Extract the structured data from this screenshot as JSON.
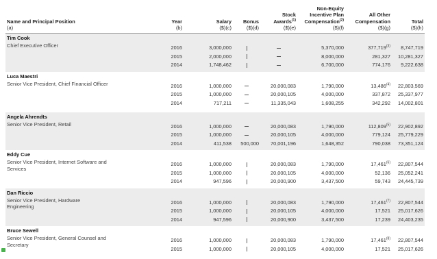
{
  "headers": {
    "name": "Name and Principal Position",
    "name_sub": "(a)",
    "year": "Year",
    "year_sub": "(b)",
    "salary": "Salary",
    "salary_sub": "($)(c)",
    "bonus": "Bonus",
    "bonus_sub": "($)(d)",
    "stock_line1": "Stock",
    "stock_line2": "Awards",
    "stock_note": "(1)",
    "stock_sub": "($)(e)",
    "nonequity_line1": "Non-Equity",
    "nonequity_line2": "Incentive Plan",
    "nonequity_line3": "Compensation",
    "nonequity_note": "(2)",
    "nonequity_sub": "($)(f)",
    "other_line1": "All Other",
    "other_line2": "Compensation",
    "other_sub": "($)(g)",
    "total": "Total",
    "total_sub": "($)(h)"
  },
  "executives": [
    {
      "name": "Tim Cook",
      "title": "Chief Executive Officer",
      "years": [
        "2016",
        "2015",
        "2014"
      ],
      "salary": [
        "3,000,000",
        "2,000,000",
        "1,748,462"
      ],
      "bonus_style": "vertical",
      "stock_awards": [
        "—",
        "—",
        "—"
      ],
      "non_equity": [
        "5,370,000",
        "8,000,000",
        "6,700,000"
      ],
      "other": [
        "377,719",
        "281,327",
        "774,176"
      ],
      "other_note": "(3)",
      "total": [
        "8,747,719",
        "10,281,327",
        "9,222,638"
      ]
    },
    {
      "name": "Luca Maestri",
      "title": "Senior Vice President, Chief Financial Officer",
      "years": [
        "2016",
        "2015",
        "2014"
      ],
      "salary": [
        "1,000,000",
        "1,000,000",
        "717,211"
      ],
      "bonus": [
        "—",
        "—",
        "—"
      ],
      "stock_awards": [
        "20,000,083",
        "20,000,105",
        "11,335,043"
      ],
      "non_equity": [
        "1,790,000",
        "4,000,000",
        "1,608,255"
      ],
      "other": [
        "13,486",
        "337,872",
        "342,292"
      ],
      "other_note": "(4)",
      "total": [
        "22,803,569",
        "25,337,977",
        "14,002,801"
      ]
    },
    {
      "name": "Angela Ahrendts",
      "title": "Senior Vice President, Retail",
      "years": [
        "2016",
        "2015",
        "2014"
      ],
      "salary": [
        "1,000,000",
        "1,000,000",
        "411,538"
      ],
      "bonus": [
        "—",
        "—",
        "500,000"
      ],
      "stock_awards": [
        "20,000,083",
        "20,000,105",
        "70,001,196"
      ],
      "non_equity": [
        "1,790,000",
        "4,000,000",
        "1,648,352"
      ],
      "other": [
        "112,809",
        "779,124",
        "790,038"
      ],
      "other_note": "(5)",
      "total": [
        "22,902,892",
        "25,779,229",
        "73,351,124"
      ]
    },
    {
      "name": "Eddy Cue",
      "title": "Senior Vice President, Internet Software and Services",
      "years": [
        "2016",
        "2015",
        "2014"
      ],
      "salary": [
        "1,000,000",
        "1,000,000",
        "947,596"
      ],
      "bonus_style": "vertical",
      "stock_awards": [
        "20,000,083",
        "20,000,105",
        "20,000,900"
      ],
      "non_equity": [
        "1,790,000",
        "4,000,000",
        "3,437,500"
      ],
      "other": [
        "17,461",
        "52,136",
        "59,743"
      ],
      "other_note": "(6)",
      "total": [
        "22,807,544",
        "25,052,241",
        "24,445,739"
      ]
    },
    {
      "name": "Dan Riccio",
      "title": "Senior Vice President, Hardware Engineering",
      "years": [
        "2016",
        "2015",
        "2014"
      ],
      "salary": [
        "1,000,000",
        "1,000,000",
        "947,596"
      ],
      "bonus_style": "vertical",
      "stock_awards": [
        "20,000,083",
        "20,000,105",
        "20,000,900"
      ],
      "non_equity": [
        "1,790,000",
        "4,000,000",
        "3,437,500"
      ],
      "other": [
        "17,461",
        "17,521",
        "17,239"
      ],
      "other_note": "(7)",
      "total": [
        "22,807,544",
        "25,017,626",
        "24,403,235"
      ]
    },
    {
      "name": "Bruce Sewell",
      "title": "Senior Vice President, General Counsel and Secretary",
      "years": [
        "2016",
        "2015"
      ],
      "salary": [
        "1,000,000",
        "1,000,000"
      ],
      "bonus_style": "vertical",
      "stock_awards": [
        "20,000,083",
        "20,000,105"
      ],
      "non_equity": [
        "1,790,000",
        "4,000,000"
      ],
      "other": [
        "17,461",
        "17,521"
      ],
      "other_note": "(8)",
      "total": [
        "22,807,544",
        "25,017,626"
      ]
    }
  ]
}
